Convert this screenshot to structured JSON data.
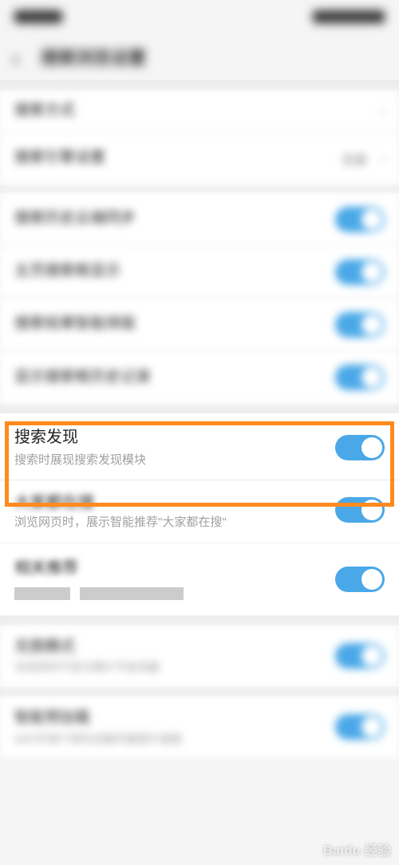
{
  "header": {
    "title": "搜索浏览设置"
  },
  "highlighted": {
    "title": "搜索发现",
    "sub": "搜索时展现搜索发现模块"
  },
  "row_below1": {
    "title": "大家都在搜",
    "sub": "浏览网页时，展示智能推荐\"大家都在搜\""
  },
  "row_below2": {
    "title": "相关推荐",
    "sub_fragment": ""
  },
  "watermark": "Baidu 经验"
}
